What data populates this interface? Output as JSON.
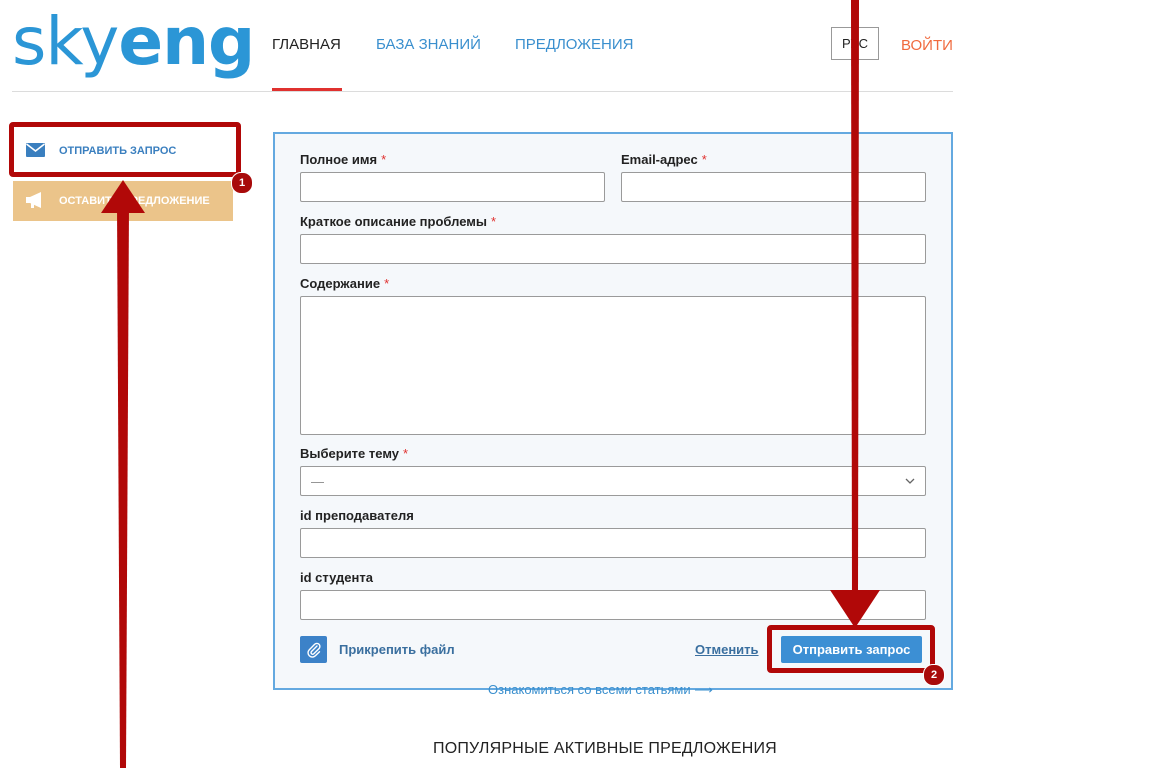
{
  "header": {
    "logo_light": "sky",
    "logo_bold": "eng",
    "nav": [
      "ГЛАВНАЯ",
      "БАЗА ЗНАНИЙ",
      "ПРЕДЛОЖЕНИЯ"
    ],
    "lang": "РУС",
    "login": "ВОЙТИ"
  },
  "sidebar": {
    "request_label": "ОТПРАВИТЬ ЗАПРОС",
    "suggest_label": "ОСТАВИТЬ ПРЕДЛОЖЕНИЕ"
  },
  "form": {
    "full_name_label": "Полное имя",
    "email_label": "Email-адрес",
    "subject_label": "Краткое описание проблемы",
    "content_label": "Содержание",
    "topic_label": "Выберите тему",
    "topic_value": "—",
    "teacher_id_label": "id преподавателя",
    "student_id_label": "id студента",
    "required_mark": "*",
    "attach_label": "Прикрепить файл",
    "cancel_label": "Отменить",
    "submit_label": "Отправить запрос"
  },
  "below": {
    "all_articles": "Ознакомиться со всеми статьями ⟶",
    "popular_title": "ПОПУЛЯРНЫЕ АКТИВНЫЕ ПРЕДЛОЖЕНИЯ"
  },
  "annotations": {
    "badge_1": "1",
    "badge_2": "2",
    "color": "#b10808"
  },
  "colors": {
    "brand_blue": "#2b96d6",
    "accent_red": "#e0312f",
    "login_orange": "#f06a3e",
    "suggest_bg": "#ebc48a"
  }
}
